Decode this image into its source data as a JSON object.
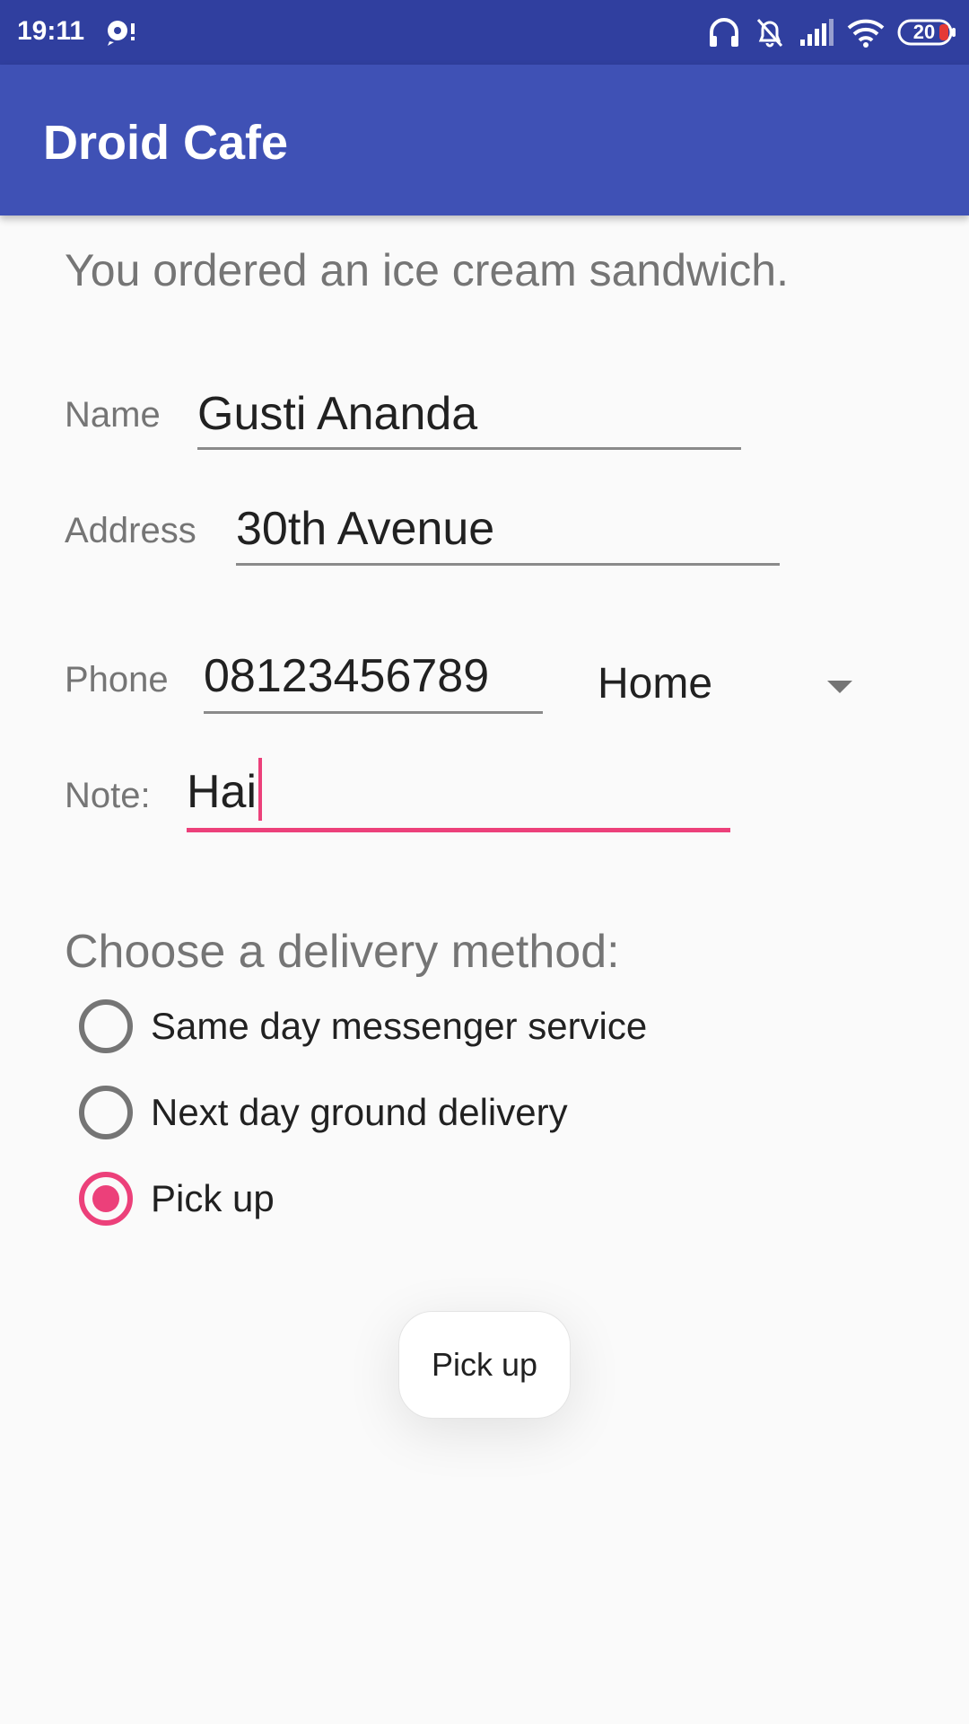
{
  "status_bar": {
    "time": "19:11",
    "battery": "20",
    "icons": [
      "notification-icon",
      "headphones-icon",
      "mute-bell-icon",
      "signal-icon",
      "wifi-icon",
      "battery-icon"
    ]
  },
  "app_bar": {
    "title": "Droid Cafe"
  },
  "order": {
    "message": "You ordered an ice cream sandwich."
  },
  "form": {
    "name": {
      "label": "Name",
      "value": "Gusti Ananda"
    },
    "address": {
      "label": "Address",
      "value": "30th Avenue"
    },
    "phone": {
      "label": "Phone",
      "value": "08123456789"
    },
    "phone_type": {
      "selected": "Home"
    },
    "note": {
      "label": "Note:",
      "value": "Hai"
    }
  },
  "delivery": {
    "title": "Choose a delivery method:",
    "options": [
      {
        "label": "Same day messenger service",
        "checked": false
      },
      {
        "label": "Next day ground delivery",
        "checked": false
      },
      {
        "label": "Pick up",
        "checked": true
      }
    ]
  },
  "toast": {
    "text": "Pick up"
  },
  "colors": {
    "status_bar": "#303f9f",
    "app_bar": "#3f51b5",
    "accent": "#ec407a",
    "secondary_text": "#757575",
    "background": "#fafafa"
  }
}
